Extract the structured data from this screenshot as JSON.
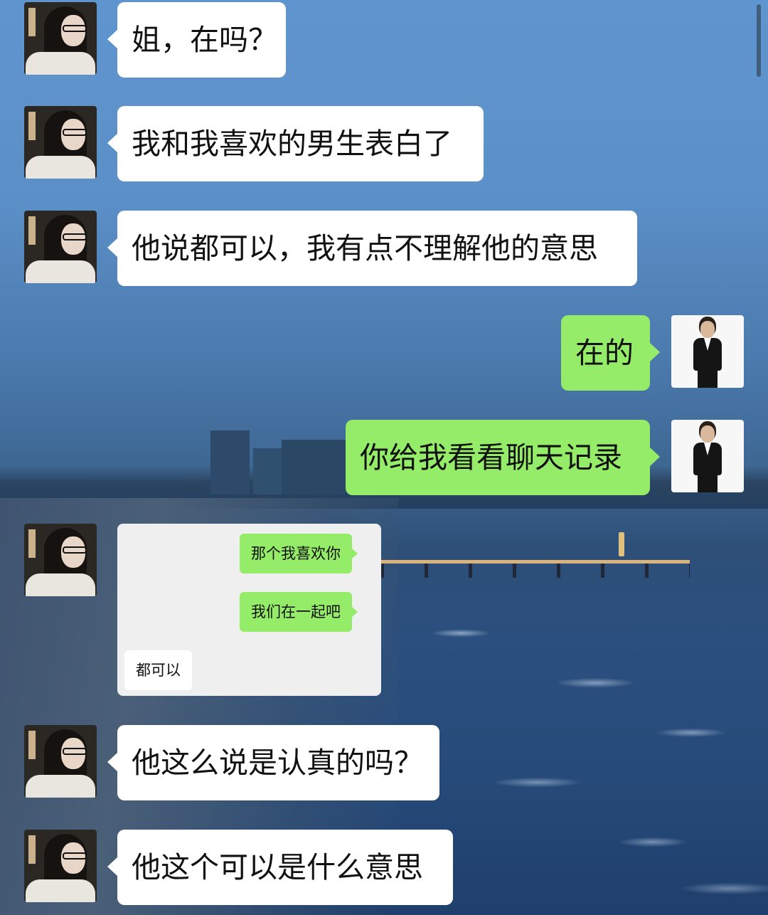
{
  "conversation": {
    "contact": {
      "avatar_icon": "girl-with-glasses-avatar"
    },
    "me": {
      "avatar_icon": "woman-in-black-suit-avatar"
    },
    "colors": {
      "incoming_bubble": "#ffffff",
      "outgoing_bubble": "#95ec69"
    },
    "messages": [
      {
        "from": "contact",
        "text": "姐，在吗？"
      },
      {
        "from": "contact",
        "text": "我和我喜欢的男生表白了"
      },
      {
        "from": "contact",
        "text": "他说都可以，我有点不理解他的意思"
      },
      {
        "from": "me",
        "text": "在的"
      },
      {
        "from": "me",
        "text": "你给我看看聊天记录"
      },
      {
        "from": "contact",
        "type": "image",
        "screenshot": {
          "messages": [
            {
              "from": "me",
              "text": "那个我喜欢你"
            },
            {
              "from": "me",
              "text": "我们在一起吧"
            },
            {
              "from": "other",
              "text": "都可以"
            }
          ]
        }
      },
      {
        "from": "contact",
        "text": "他这么说是认真的吗？"
      },
      {
        "from": "contact",
        "text": "他这个可以是什么意思"
      }
    ]
  }
}
